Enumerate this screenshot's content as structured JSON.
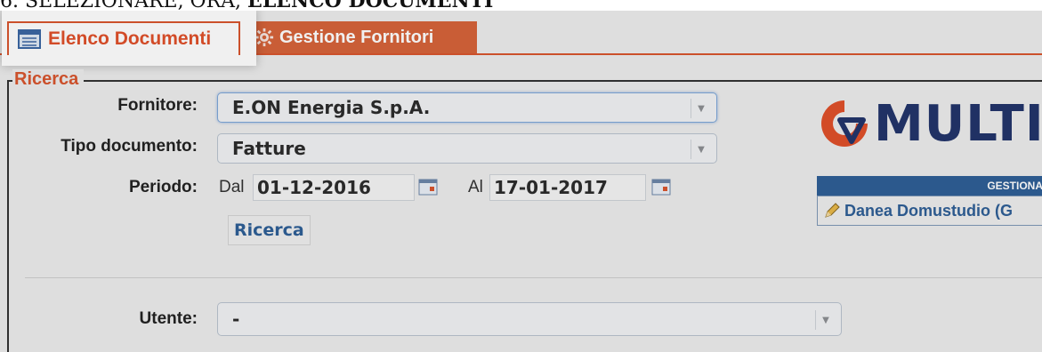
{
  "heading": {
    "number": "6.",
    "text": "SELEZIONARE, ORA, ",
    "bold": "ELENCO DOCUMENTI"
  },
  "tabs": {
    "elenco": {
      "label": "Elenco Documenti",
      "icon": "list-icon"
    },
    "gestione": {
      "label": "Gestione Fornitori",
      "icon": "gear-icon"
    }
  },
  "ricerca": {
    "legend": "Ricerca",
    "fornitore": {
      "label": "Fornitore:",
      "value": "E.ON Energia S.p.A."
    },
    "tipo": {
      "label": "Tipo documento:",
      "value": "Fatture"
    },
    "periodo": {
      "label": "Periodo:",
      "dal_label": "Dal",
      "dal_value": "01-12-2016",
      "al_label": "Al",
      "al_value": "17-01-2017"
    },
    "button": "Ricerca",
    "utente": {
      "label": "Utente:",
      "value": "-"
    }
  },
  "side": {
    "logo_text": "MULTI",
    "gestione_header": "GESTIONA",
    "gestione_item": "Danea Domustudio (G"
  },
  "colors": {
    "accent": "#d8552e",
    "brand": "#23356b",
    "link": "#2f5f96"
  }
}
